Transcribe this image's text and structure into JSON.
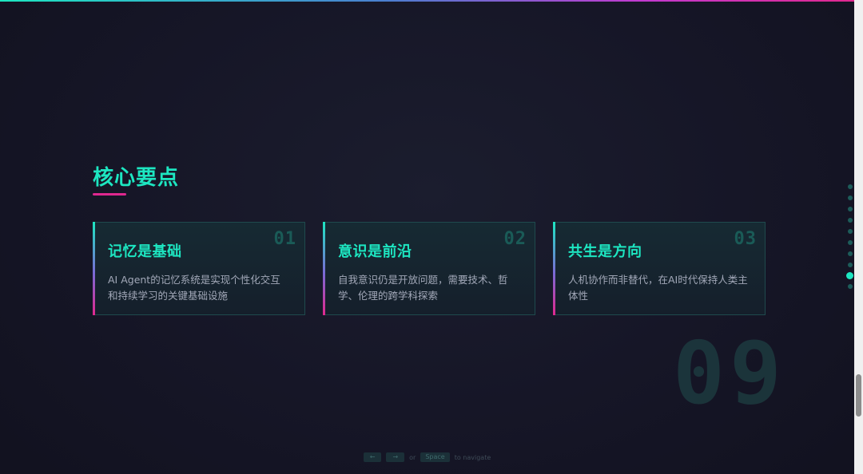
{
  "slide": {
    "title": "核心要点",
    "big_number": "09"
  },
  "cards": [
    {
      "number": "01",
      "title": "记忆是基础",
      "desc": "AI Agent的记忆系统是实现个性化交互和持续学习的关键基础设施"
    },
    {
      "number": "02",
      "title": "意识是前沿",
      "desc": "自我意识仍是开放问题，需要技术、哲学、伦理的跨学科探索"
    },
    {
      "number": "03",
      "title": "共生是方向",
      "desc": "人机协作而非替代，在AI时代保持人类主体性"
    }
  ],
  "nav_hint": {
    "key_left": "←",
    "key_right": "→",
    "or": "or",
    "key_space": "Space",
    "suffix": "to navigate"
  },
  "colors": {
    "accent": "#1de6c1",
    "pink": "#e0288f",
    "background": "#13131f"
  }
}
